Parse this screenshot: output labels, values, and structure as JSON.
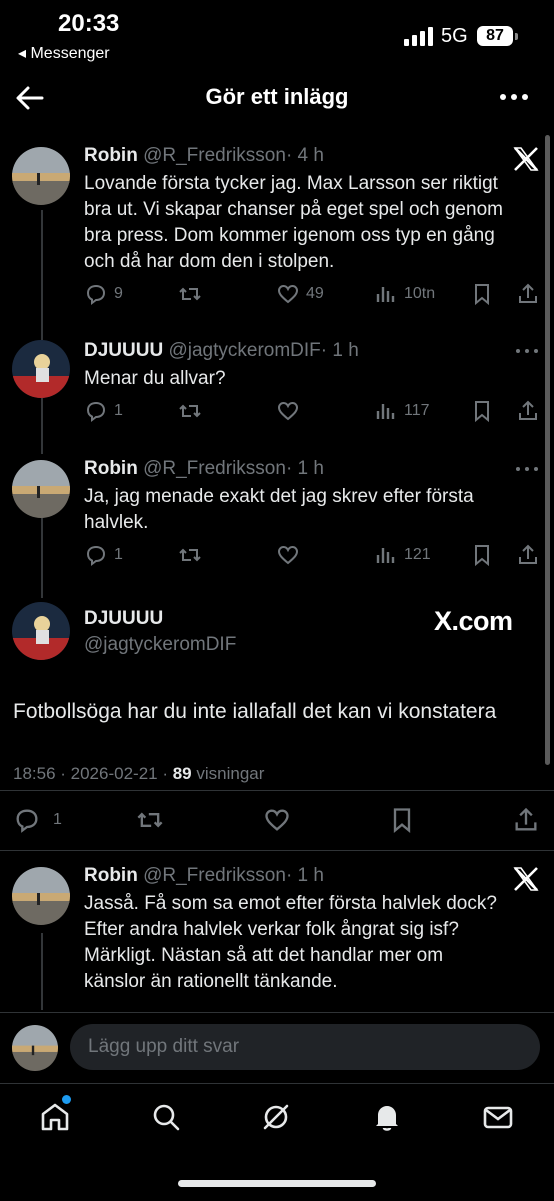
{
  "status_bar": {
    "time": "20:33",
    "back_app": "◂ Messenger",
    "network": "5G",
    "battery": "87"
  },
  "header": {
    "title": "Gör ett inlägg"
  },
  "tweets": [
    {
      "name": "Robin",
      "handle": "@R_Fredriksson",
      "time": "· 4 h",
      "text_lines": [
        "Lovande första tycker jag. Max Larsson ser riktigt",
        "bra ut. Vi skapar chanser på eget spel och genom",
        "bra press. Dom kommer igenom oss typ en gång",
        "och då har dom den i stolpen."
      ],
      "replies": "9",
      "retweets": "",
      "likes": "49",
      "views": "10tn"
    },
    {
      "name": "DJUUUU",
      "handle": "@jagtyckeromDIF",
      "time": "· 1 h",
      "text_lines": [
        "Menar du allvar?"
      ],
      "replies": "1",
      "retweets": "",
      "likes": "",
      "views": "117"
    },
    {
      "name": "Robin",
      "handle": "@R_Fredriksson",
      "time": "· 1 h",
      "text_lines": [
        "Ja, jag menade exakt det jag skrev efter första",
        "halvlek."
      ],
      "replies": "1",
      "retweets": "",
      "likes": "",
      "views": "121"
    }
  ],
  "focus_post": {
    "name": "DJUUUU",
    "handle": "@jagtyckeromDIF",
    "brand": "X.com",
    "text": "Fotbollsöga har du inte iallafall det kan vi konstatera",
    "datetime": "18:56 · 2026-02-21 · ",
    "views_count": "89",
    "views_label": " visningar",
    "replies": "1"
  },
  "last_tweet": {
    "name": "Robin",
    "handle": "@R_Fredriksson",
    "time": "· 1 h",
    "text_lines": [
      "Jasså. Få som sa emot efter första halvlek dock?",
      "Efter andra halvlek verkar folk ångrat sig isf?",
      "Märkligt. Nästan så att det handlar mer om",
      "känslor än rationellt tänkande."
    ]
  },
  "reply_bar": {
    "placeholder": "Lägg upp ditt svar"
  },
  "tabs": [
    "home-icon",
    "search-icon",
    "grok-icon",
    "bell-icon",
    "mail-icon"
  ],
  "colors": {
    "background": "#000000",
    "text": "#e7e9ea",
    "secondary": "#71767b",
    "accent": "#1d9bf0"
  }
}
